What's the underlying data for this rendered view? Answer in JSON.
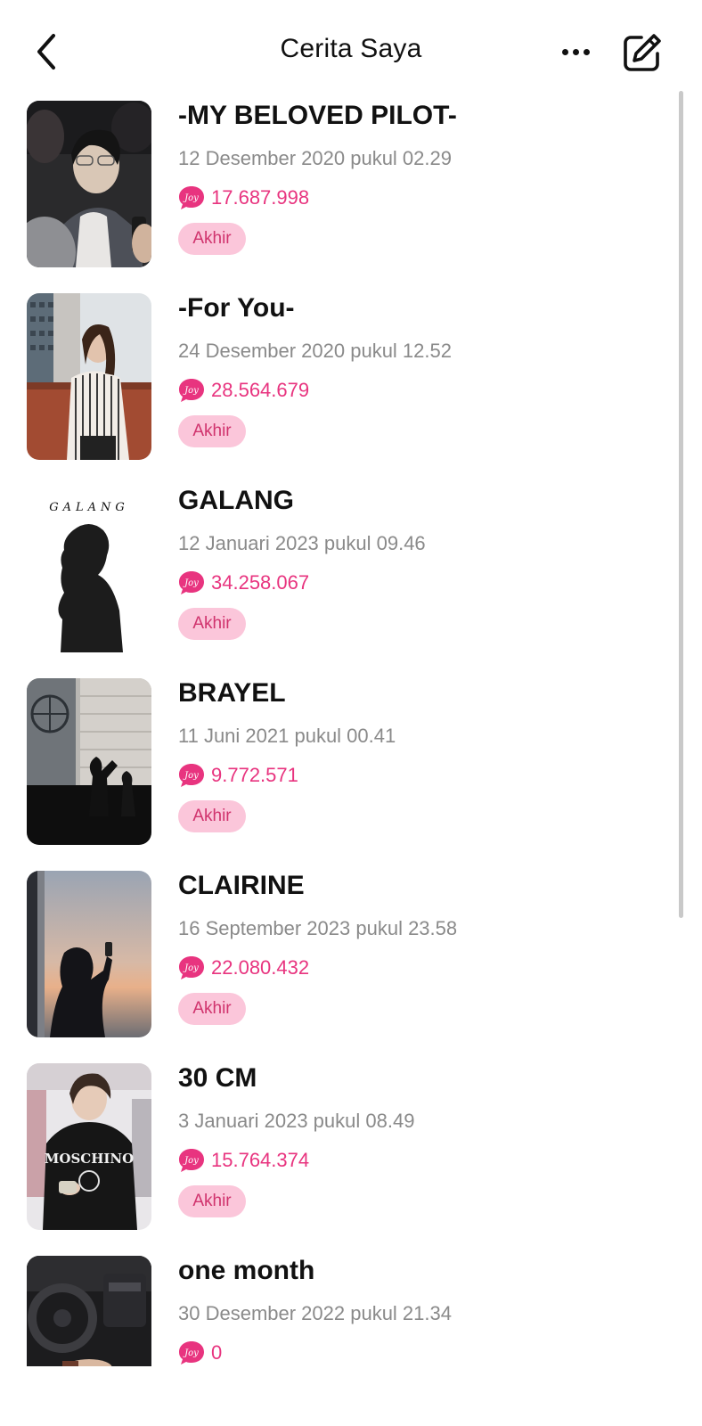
{
  "header": {
    "title": "Cerita Saya",
    "back_icon": "chevron-left-icon",
    "more_icon": "ellipsis-icon",
    "edit_icon": "edit-icon"
  },
  "colors": {
    "accent": "#e8347f",
    "badge_bg": "#fbc6da",
    "badge_text": "#d0336d",
    "muted_text": "#8a8a8a"
  },
  "reads_icon": "joy-icon",
  "reads_icon_text": "Joy",
  "stories": [
    {
      "title": "-MY BELOVED PILOT-",
      "date": "12 Desember 2020 pukul 02.29",
      "reads": "17.687.998",
      "status": "Akhir"
    },
    {
      "title": "-For You-",
      "date": "24 Desember 2020 pukul 12.52",
      "reads": "28.564.679",
      "status": "Akhir"
    },
    {
      "title": "GALANG",
      "date": "12 Januari 2023 pukul 09.46",
      "reads": "34.258.067",
      "status": "Akhir",
      "cover_text": "GALANG"
    },
    {
      "title": "BRAYEL",
      "date": "11 Juni 2021 pukul 00.41",
      "reads": "9.772.571",
      "status": "Akhir"
    },
    {
      "title": "CLAIRINE",
      "date": "16 September 2023 pukul 23.58",
      "reads": "22.080.432",
      "status": "Akhir"
    },
    {
      "title": "30 CM",
      "date": "3 Januari 2023 pukul 08.49",
      "reads": "15.764.374",
      "status": "Akhir",
      "cover_text": "MOSCHINO"
    },
    {
      "title": "one month",
      "date": "30 Desember 2022 pukul 21.34",
      "reads": "0"
    }
  ]
}
